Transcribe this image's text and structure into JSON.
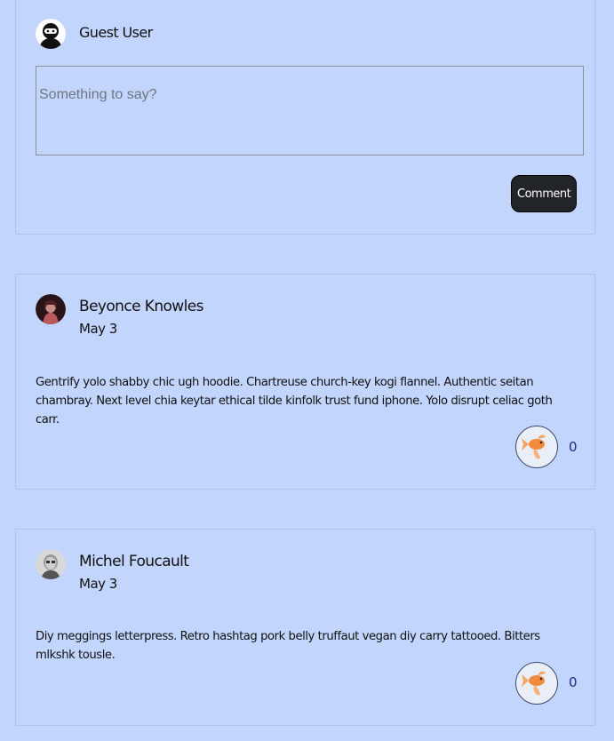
{
  "composer": {
    "user_name": "Guest User",
    "avatar_icon": "ninja-avatar-icon",
    "placeholder": "Something to say?",
    "value": "",
    "submit_label": "Comment"
  },
  "posts": [
    {
      "author": "Beyonce Knowles",
      "date": "May 3",
      "body": "Gentrify yolo shabby chic ugh hoodie. Chartreuse church-key kogi flannel. Authentic seitan chambray. Next level chia keytar ethical tilde kinfolk trust fund iphone. Yolo disrupt celiac goth carr.",
      "like_icon": "goldfish-icon",
      "likes": "0"
    },
    {
      "author": "Michel Foucault",
      "date": "May 3",
      "body": "Diy meggings letterpress. Retro hashtag pork belly truffaut vegan diy carry tattooed. Bitters mlkshk tousle.",
      "like_icon": "goldfish-icon",
      "likes": "0"
    }
  ],
  "colors": {
    "background": "#c2d6fd",
    "button_dark": "#212529",
    "like_count": "#1a2b8a"
  }
}
